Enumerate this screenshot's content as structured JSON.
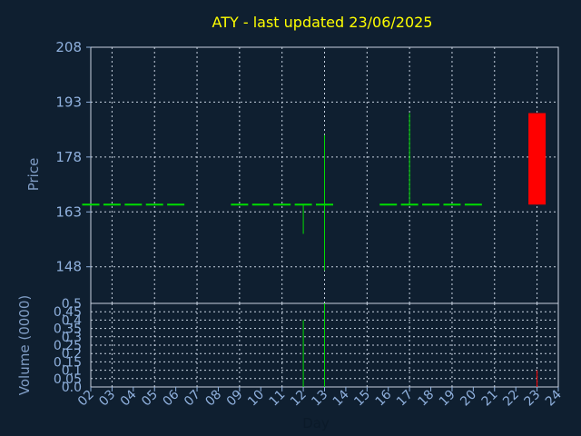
{
  "chart_data": {
    "title": "ATY - last updated 23/06/2025",
    "price_chart": {
      "type": "candlestick",
      "ylabel": "Price",
      "ylim": [
        138,
        208
      ],
      "yticks": [
        148,
        163,
        178,
        193,
        208
      ],
      "grid": true
    },
    "volume_chart": {
      "type": "bar",
      "ylabel": "Volume (0000)",
      "ylim": [
        0,
        0.5
      ],
      "yticks": [
        "0.0",
        "0.05",
        "0.1",
        "0.15",
        "0.2",
        "0.25",
        "0.3",
        "0.35",
        "0.4",
        "0.45",
        "0.5"
      ],
      "grid": true
    },
    "xlabel": "Day",
    "x_ticks": [
      "02",
      "03",
      "04",
      "05",
      "06",
      "07",
      "08",
      "09",
      "10",
      "11",
      "12",
      "13",
      "14",
      "15",
      "16",
      "17",
      "18",
      "19",
      "20",
      "21",
      "22",
      "23",
      "24"
    ],
    "candles": [
      {
        "day": 2,
        "open": 165,
        "high": 165,
        "low": 165,
        "close": 165,
        "volume": 0
      },
      {
        "day": 3,
        "open": 165,
        "high": 165,
        "low": 165,
        "close": 165,
        "volume": 0
      },
      {
        "day": 4,
        "open": 165,
        "high": 165,
        "low": 165,
        "close": 165,
        "volume": 0
      },
      {
        "day": 5,
        "open": 165,
        "high": 165,
        "low": 165,
        "close": 165,
        "volume": 0
      },
      {
        "day": 6,
        "open": 165,
        "high": 165,
        "low": 165,
        "close": 165,
        "volume": 0
      },
      {
        "day": 9,
        "open": 165,
        "high": 165,
        "low": 165,
        "close": 165,
        "volume": 0
      },
      {
        "day": 10,
        "open": 165,
        "high": 165,
        "low": 165,
        "close": 165,
        "volume": 0
      },
      {
        "day": 11,
        "open": 165,
        "high": 165,
        "low": 165,
        "close": 165,
        "volume": 0
      },
      {
        "day": 12,
        "open": 165,
        "high": 165,
        "low": 157,
        "close": 165,
        "volume": 0.4
      },
      {
        "day": 13,
        "open": 165,
        "high": 184,
        "low": 147,
        "close": 165,
        "volume": 0.5
      },
      {
        "day": 16,
        "open": 165,
        "high": 165,
        "low": 165,
        "close": 165,
        "volume": 0
      },
      {
        "day": 17,
        "open": 165,
        "high": 190,
        "low": 165,
        "close": 165,
        "volume": 0
      },
      {
        "day": 18,
        "open": 165,
        "high": 165,
        "low": 165,
        "close": 165,
        "volume": 0
      },
      {
        "day": 19,
        "open": 165,
        "high": 165,
        "low": 165,
        "close": 165,
        "volume": 0
      },
      {
        "day": 20,
        "open": 165,
        "high": 165,
        "low": 165,
        "close": 165,
        "volume": 0
      },
      {
        "day": 23,
        "open": 190,
        "high": 190,
        "low": 165,
        "close": 165,
        "volume": 0.1
      }
    ],
    "colors": {
      "background": "#0f1f30",
      "up": "#00dd00",
      "down": "#ff0000",
      "grid": "#c8d2e0",
      "axis": "#8fb0dd",
      "title": "#ffff00"
    }
  }
}
